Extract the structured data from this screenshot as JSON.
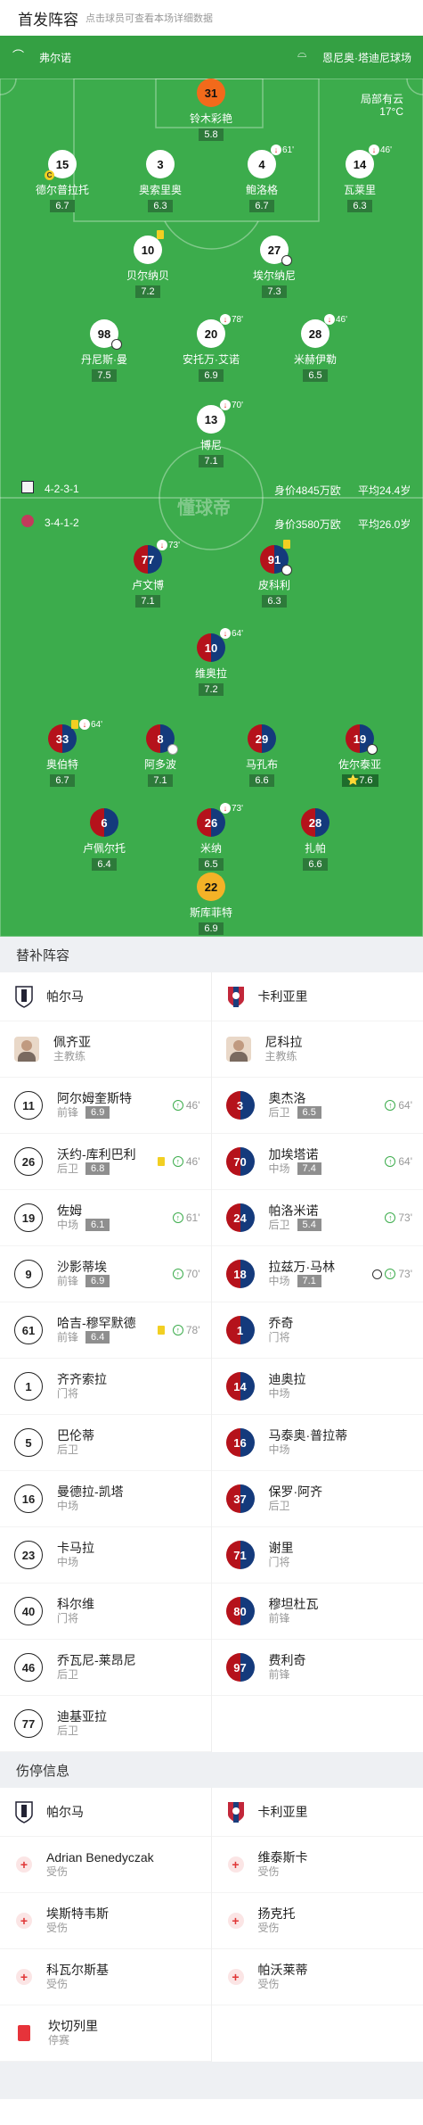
{
  "header": {
    "title": "首发阵容",
    "subtitle": "点击球员可查看本场详细数据"
  },
  "pitch": {
    "top_left": "弗尔诺",
    "top_right": "恩尼奥·塔迪尼球场",
    "weather": "局部有云",
    "temperature": "17°C",
    "watermark": "懂球帝",
    "home": {
      "formation": "4-2-3-1",
      "value": "身价4845万欧",
      "age": "平均24.4岁"
    },
    "away": {
      "formation": "3-4-1-2",
      "value": "身价3580万欧",
      "age": "平均26.0岁"
    },
    "players": [
      {
        "num": "31",
        "name": "铃木彩艳",
        "rating": "5.8"
      },
      {
        "num": "15",
        "name": "德尔普拉托",
        "rating": "6.7",
        "captain": "C"
      },
      {
        "num": "3",
        "name": "奥索里奥",
        "rating": "6.3"
      },
      {
        "num": "4",
        "name": "鲍洛格",
        "rating": "6.7",
        "sub_time": "61'"
      },
      {
        "num": "14",
        "name": "瓦莱里",
        "rating": "6.3",
        "sub_time": "46'"
      },
      {
        "num": "10",
        "name": "贝尔纳贝",
        "rating": "7.2"
      },
      {
        "num": "27",
        "name": "埃尔纳尼",
        "rating": "7.3"
      },
      {
        "num": "98",
        "name": "丹尼斯·曼",
        "rating": "7.5"
      },
      {
        "num": "20",
        "name": "安托万·艾诺",
        "rating": "6.9",
        "sub_time": "78'"
      },
      {
        "num": "28",
        "name": "米赫伊勒",
        "rating": "6.5",
        "sub_time": "46'"
      },
      {
        "num": "13",
        "name": "博尼",
        "rating": "7.1",
        "sub_time": "70'"
      },
      {
        "num": "77",
        "name": "卢文博",
        "rating": "7.1",
        "sub_time": "73'"
      },
      {
        "num": "91",
        "name": "皮科利",
        "rating": "6.3"
      },
      {
        "num": "10",
        "name": "维奥拉",
        "rating": "7.2",
        "sub_time": "64'"
      },
      {
        "num": "33",
        "name": "奥伯特",
        "rating": "6.7",
        "sub_time": "64'"
      },
      {
        "num": "8",
        "name": "阿多波",
        "rating": "7.1"
      },
      {
        "num": "29",
        "name": "马孔布",
        "rating": "6.6"
      },
      {
        "num": "19",
        "name": "佐尔泰亚",
        "rating": "7.6",
        "star": "⭐"
      },
      {
        "num": "6",
        "name": "卢佩尔托",
        "rating": "6.4"
      },
      {
        "num": "26",
        "name": "米纳",
        "rating": "6.5",
        "sub_time": "73'"
      },
      {
        "num": "28",
        "name": "扎帕",
        "rating": "6.6"
      },
      {
        "num": "22",
        "name": "斯库菲特",
        "rating": "6.9"
      }
    ]
  },
  "subs": {
    "section_title": "替补阵容",
    "home_team": "帕尔马",
    "away_team": "卡利亚里",
    "home_coach": {
      "name": "佩齐亚",
      "role": "主教练"
    },
    "away_coach": {
      "name": "尼科拉",
      "role": "主教练"
    },
    "home": [
      {
        "num": "11",
        "name": "阿尔姆奎斯特",
        "pos": "前锋",
        "rating": "6.9",
        "time": "46'"
      },
      {
        "num": "26",
        "name": "沃约-库利巴利",
        "pos": "后卫",
        "rating": "6.8",
        "time": "46'"
      },
      {
        "num": "19",
        "name": "佐姆",
        "pos": "中场",
        "rating": "6.1",
        "time": "61'"
      },
      {
        "num": "9",
        "name": "沙影蒂埃",
        "pos": "前锋",
        "rating": "6.9",
        "time": "70'"
      },
      {
        "num": "61",
        "name": "哈吉-穆罕默德",
        "pos": "前锋",
        "rating": "6.4",
        "time": "78'"
      },
      {
        "num": "1",
        "name": "齐齐索拉",
        "pos": "门将"
      },
      {
        "num": "5",
        "name": "巴伦蒂",
        "pos": "后卫"
      },
      {
        "num": "16",
        "name": "曼德拉-凯塔",
        "pos": "中场"
      },
      {
        "num": "23",
        "name": "卡马拉",
        "pos": "中场"
      },
      {
        "num": "40",
        "name": "科尔维",
        "pos": "门将"
      },
      {
        "num": "46",
        "name": "乔瓦尼-莱昂尼",
        "pos": "后卫"
      },
      {
        "num": "77",
        "name": "迪基亚拉",
        "pos": "后卫"
      }
    ],
    "away": [
      {
        "num": "3",
        "name": "奥杰洛",
        "pos": "后卫",
        "rating": "6.5",
        "time": "64'"
      },
      {
        "num": "70",
        "name": "加埃塔诺",
        "pos": "中场",
        "rating": "7.4",
        "time": "64'"
      },
      {
        "num": "24",
        "name": "帕洛米诺",
        "pos": "后卫",
        "rating": "5.4",
        "time": "73'"
      },
      {
        "num": "18",
        "name": "拉兹万·马林",
        "pos": "中场",
        "rating": "7.1",
        "time": "73'"
      },
      {
        "num": "1",
        "name": "乔奇",
        "pos": "门将"
      },
      {
        "num": "14",
        "name": "迪奥拉",
        "pos": "中场"
      },
      {
        "num": "16",
        "name": "马泰奥·普拉蒂",
        "pos": "中场"
      },
      {
        "num": "37",
        "name": "保罗·阿齐",
        "pos": "后卫"
      },
      {
        "num": "71",
        "name": "谢里",
        "pos": "门将"
      },
      {
        "num": "80",
        "name": "穆坦杜瓦",
        "pos": "前锋"
      },
      {
        "num": "97",
        "name": "费利奇",
        "pos": "前锋"
      }
    ]
  },
  "injuries": {
    "section_title": "伤停信息",
    "home_team": "帕尔马",
    "away_team": "卡利亚里",
    "home": [
      {
        "name": "Adrian Benedyczak",
        "status": "受伤"
      },
      {
        "name": "埃斯特韦斯",
        "status": "受伤"
      },
      {
        "name": "科瓦尔斯基",
        "status": "受伤"
      },
      {
        "name": "坎切列里",
        "status": "停赛"
      }
    ],
    "away": [
      {
        "name": "维泰斯卡",
        "status": "受伤"
      },
      {
        "name": "扬克托",
        "status": "受伤"
      },
      {
        "name": "帕沃莱蒂",
        "status": "受伤"
      }
    ]
  },
  "colors": {
    "pitch": "#3cac4c",
    "sub_green": "#3cac4c",
    "injury_red": "#e03838"
  }
}
